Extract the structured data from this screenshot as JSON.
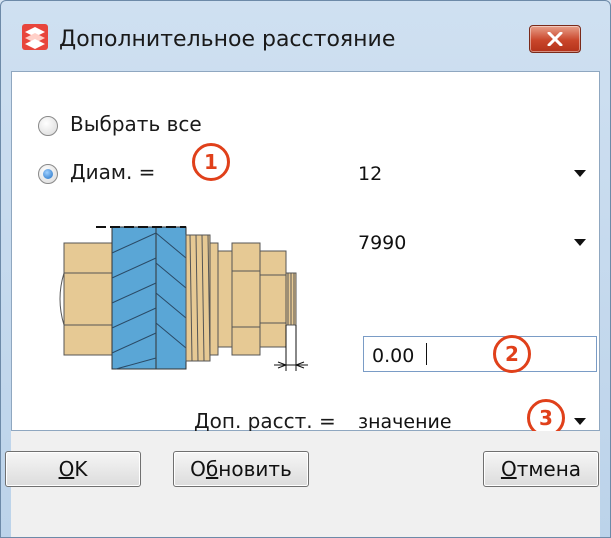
{
  "window": {
    "title": "Дополнительное расстояние"
  },
  "options": {
    "select_all_label": "Выбрать все",
    "select_all_checked": false,
    "diameter_label": "Диам. =",
    "diameter_checked": true
  },
  "fields": {
    "diameter_value": "12",
    "item_value": "7990",
    "distance_value": "0.00",
    "extra_distance_label": "Доп. расст. =",
    "extra_distance_value": "значение"
  },
  "callouts": [
    "1",
    "2",
    "3"
  ],
  "buttons": {
    "ok": {
      "mnemonic": "O",
      "rest": "K"
    },
    "refresh": {
      "before": "О",
      "mnemonic": "б",
      "rest": "новить"
    },
    "cancel": {
      "mnemonic": "О",
      "rest": "тмена"
    }
  },
  "colors": {
    "accent_callout": "#e0401a",
    "selected_radio": "#1f6fc4",
    "close_button": "#c9462b",
    "bolt_tan": "#e6c994",
    "plate_blue": "#5aa6d6"
  },
  "icons": [
    "app-logo-icon",
    "close-icon",
    "chevron-down-icon",
    "fastener-assembly-icon"
  ]
}
